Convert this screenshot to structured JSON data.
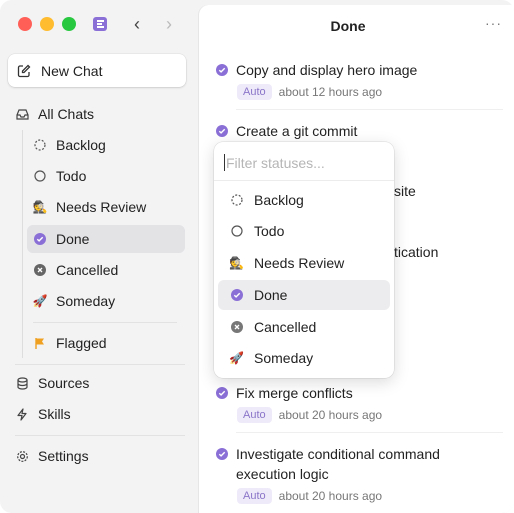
{
  "header": {
    "title": "Done",
    "more_label": "···"
  },
  "sidebar": {
    "new_chat_label": "New Chat",
    "all_chats_label": "All Chats",
    "statuses": [
      {
        "label": "Backlog",
        "icon": "dashed-circle-icon"
      },
      {
        "label": "Todo",
        "icon": "circle-icon"
      },
      {
        "label": "Needs Review",
        "icon": "detective-icon"
      },
      {
        "label": "Done",
        "icon": "check-circle-icon",
        "selected": true
      },
      {
        "label": "Cancelled",
        "icon": "x-circle-icon"
      },
      {
        "label": "Someday",
        "icon": "rocket-icon"
      }
    ],
    "flagged_label": "Flagged",
    "sources_label": "Sources",
    "skills_label": "Skills",
    "settings_label": "Settings"
  },
  "tasks": [
    {
      "title": "Copy and display hero image",
      "badge": "Auto",
      "time": "about 12 hours ago"
    },
    {
      "title": "Create a git commit",
      "badge": "",
      "time": ""
    },
    {
      "title_fragment_1": "site"
    },
    {
      "title_fragment_2": "tication"
    },
    {
      "title": "Fix merge conflicts",
      "badge": "Auto",
      "time": "about 20 hours ago"
    },
    {
      "title_line1": "Investigate conditional command",
      "title_line2": "execution logic",
      "badge": "Auto",
      "time": "about 20 hours ago"
    }
  ],
  "dropdown": {
    "placeholder": "Filter statuses...",
    "options": [
      {
        "label": "Backlog"
      },
      {
        "label": "Todo"
      },
      {
        "label": "Needs Review"
      },
      {
        "label": "Done",
        "selected": true
      },
      {
        "label": "Cancelled"
      },
      {
        "label": "Someday"
      }
    ]
  },
  "colors": {
    "accent": "#8a6fd6",
    "selected_bg": "#e3e3e6",
    "badge_bg": "#efeaf9",
    "badge_text": "#8a75c9"
  }
}
